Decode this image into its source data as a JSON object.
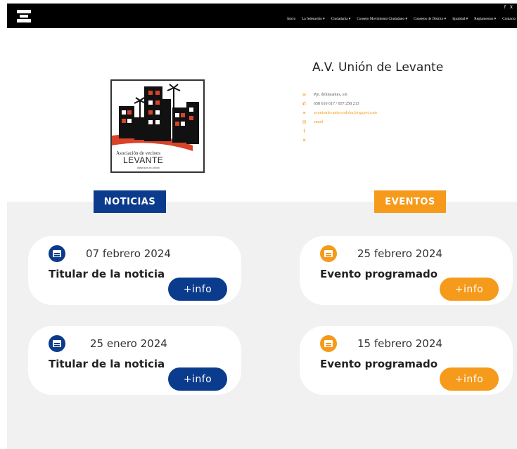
{
  "nav": {
    "items": [
      "Inicio",
      "La federación ▾",
      "Ciudadanía ▾",
      "Consejo Movimiento Ciudadano ▾",
      "Consejos de Distrito ▾",
      "Igualdad ▾",
      "Reglamentos ▾",
      "Contacto"
    ],
    "social": "f X"
  },
  "org": {
    "logo_line1": "Asociación de vecinos",
    "logo_line2": "LEVANTE",
    "logo_line3": "www.sxx.xx.xxxxx",
    "name": "A.V. Unión de Levante"
  },
  "contact": [
    {
      "icon": "address-icon",
      "glyph": "≡",
      "text": "Pje. delineantes, s/n",
      "link": false
    },
    {
      "icon": "phone-icon",
      "glyph": "✆",
      "text": "658 610 617 / 957 258 213",
      "link": false
    },
    {
      "icon": "link-icon",
      "glyph": "⚭",
      "text": "avunionlevantecordoba.blogspot.com",
      "link": true
    },
    {
      "icon": "email-icon",
      "glyph": "✉",
      "text": "email",
      "link": true
    },
    {
      "icon": "facebook-icon",
      "glyph": "f",
      "text": "",
      "link": true
    },
    {
      "icon": "x-icon",
      "glyph": "✕",
      "text": "",
      "link": true
    }
  ],
  "sections": {
    "news_title": "NOTICIAS",
    "events_title": "EVENTOS"
  },
  "news": [
    {
      "date": "07 febrero 2024",
      "title": "Titular de la noticia",
      "button": "+info"
    },
    {
      "date": "25 enero 2024",
      "title": "Titular de la noticia",
      "button": "+info"
    }
  ],
  "events": [
    {
      "date": "25 febrero 2024",
      "title": "Evento programado",
      "button": "+info"
    },
    {
      "date": "15 febrero 2024",
      "title": "Evento programado",
      "button": "+info"
    }
  ],
  "colors": {
    "primary_blue": "#0b3b8c",
    "accent_orange": "#f59a1a",
    "topbar": "#000000",
    "gray_bg": "#f1f1f1"
  }
}
